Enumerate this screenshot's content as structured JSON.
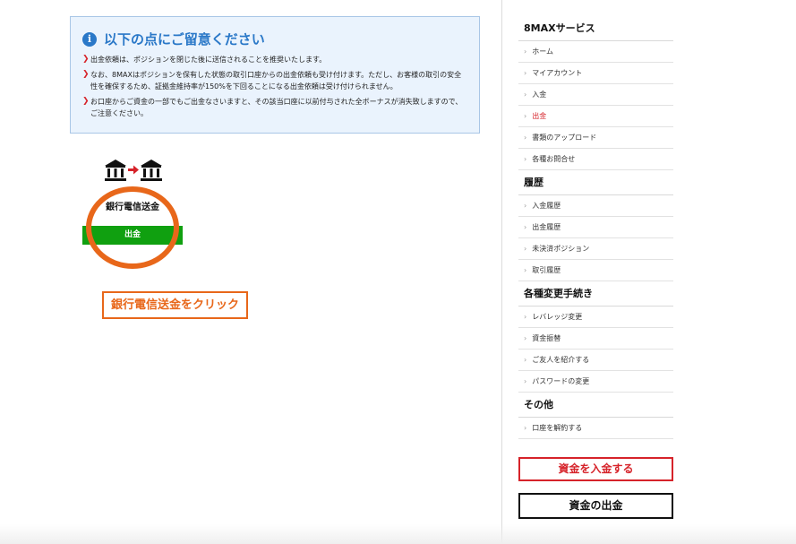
{
  "notice": {
    "title": "以下の点にご留意ください",
    "items": [
      "出金依頼は、ポジションを閉じた後に送信されることを推奨いたします。",
      "なお、8MAXはポジションを保有した状態の取引口座からの出金依頼も受け付けます。ただし、お客様の取引の安全性を確保するため、証拠金維持率が150%を下回ることになる出金依頼は受け付けられません。",
      "お口座からご資金の一部でもご出金なさいますと、その該当口座に以前付与された全ボーナスが消失致しますので、ご注意ください。"
    ]
  },
  "bank_card": {
    "label": "銀行電信送金",
    "button": "出金"
  },
  "callout": "銀行電信送金をクリック",
  "sidebar": {
    "sections": [
      {
        "heading": "8MAXサービス",
        "items": [
          "ホーム",
          "マイアカウント",
          "入金",
          "出金",
          "書類のアップロード",
          "各種お問合せ"
        ]
      },
      {
        "heading": "履歴",
        "items": [
          "入金履歴",
          "出金履歴",
          "未決済ポジション",
          "取引履歴"
        ]
      },
      {
        "heading": "各種変更手続き",
        "items": [
          "レバレッジ変更",
          "資金振替",
          "ご友人を紹介する",
          "パスワードの変更"
        ]
      },
      {
        "heading": "その他",
        "items": [
          "口座を解約する"
        ]
      }
    ],
    "active_item": "出金",
    "deposit_button": "資金を入金する",
    "withdraw_button": "資金の出金"
  },
  "icons": {
    "info": "info-icon",
    "bank": "bank-icon",
    "arrow": "arrow-right-icon",
    "chevron": "chevron-right-icon"
  },
  "colors": {
    "accent_blue": "#2a78c8",
    "accent_red": "#d6232a",
    "button_green": "#10a010",
    "annotation_orange": "#e8671a"
  }
}
